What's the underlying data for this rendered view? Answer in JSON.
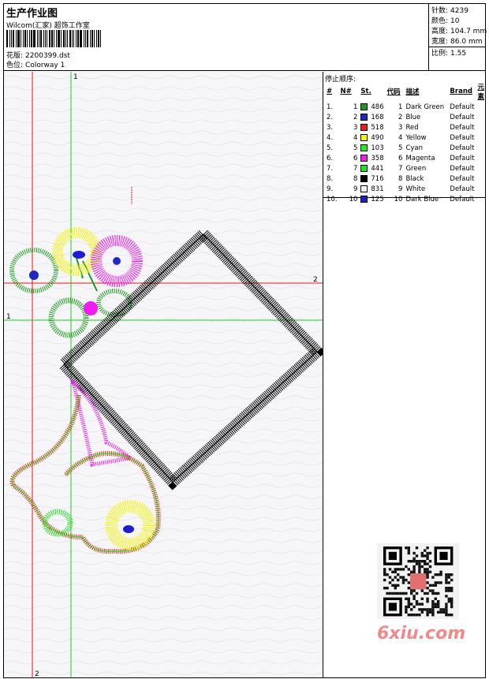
{
  "header": {
    "title": "生产作业图",
    "org": "Wilcom(汇家) 超饰工作室",
    "design_label": "花版:",
    "design_value": "2200399.dst",
    "colorway_label": "色位:",
    "colorway_value": "Colorway 1"
  },
  "stats": {
    "stitches_label": "针数:",
    "stitches_value": "4239",
    "colors_label": "颜色:",
    "colors_value": "10",
    "height_label": "高度:",
    "height_value": "104.7 mm",
    "width_label": "宽度:",
    "width_value": "86.0 mm",
    "ratio_label": "比例:",
    "ratio_value": "1.55"
  },
  "guides": {
    "v1": "1",
    "v2": "2",
    "h1": "1",
    "h2": "2"
  },
  "panel": {
    "stop_sequence_label": "停止顺序:",
    "columns": [
      "#",
      "N#",
      "St.",
      "代码",
      "描述",
      "Brand",
      "元素"
    ],
    "rows": [
      {
        "idx": "1.",
        "n": "1",
        "color": "#1a9a1a",
        "st": "486",
        "code": "1",
        "desc": "Dark Green",
        "brand": "Default"
      },
      {
        "idx": "2.",
        "n": "2",
        "color": "#1c28c8",
        "st": "168",
        "code": "2",
        "desc": "Blue",
        "brand": "Default"
      },
      {
        "idx": "3.",
        "n": "3",
        "color": "#ee1c1c",
        "st": "518",
        "code": "3",
        "desc": "Red",
        "brand": "Default"
      },
      {
        "idx": "4.",
        "n": "4",
        "color": "#f4f400",
        "st": "490",
        "code": "4",
        "desc": "Yellow",
        "brand": "Default"
      },
      {
        "idx": "5.",
        "n": "5",
        "color": "#1cf01c",
        "st": "103",
        "code": "5",
        "desc": "Cyan",
        "brand": "Default"
      },
      {
        "idx": "6.",
        "n": "6",
        "color": "#f01cf0",
        "st": "358",
        "code": "6",
        "desc": "Magenta",
        "brand": "Default"
      },
      {
        "idx": "7.",
        "n": "7",
        "color": "#22e022",
        "st": "441",
        "code": "7",
        "desc": "Green",
        "brand": "Default"
      },
      {
        "idx": "8.",
        "n": "8",
        "color": "#000000",
        "st": "716",
        "code": "8",
        "desc": "Black",
        "brand": "Default"
      },
      {
        "idx": "9.",
        "n": "9",
        "color": "#f4f4f4",
        "st": "831",
        "code": "9",
        "desc": "White",
        "brand": "Default"
      },
      {
        "idx": "10.",
        "n": "10",
        "color": "#1c1cd0",
        "st": "125",
        "code": "10",
        "desc": "Dark Blue",
        "brand": "Default"
      }
    ],
    "watermark": "6xiu.com"
  },
  "colors": {
    "guide_red": "#ee1111",
    "guide_green": "#22cc22"
  }
}
